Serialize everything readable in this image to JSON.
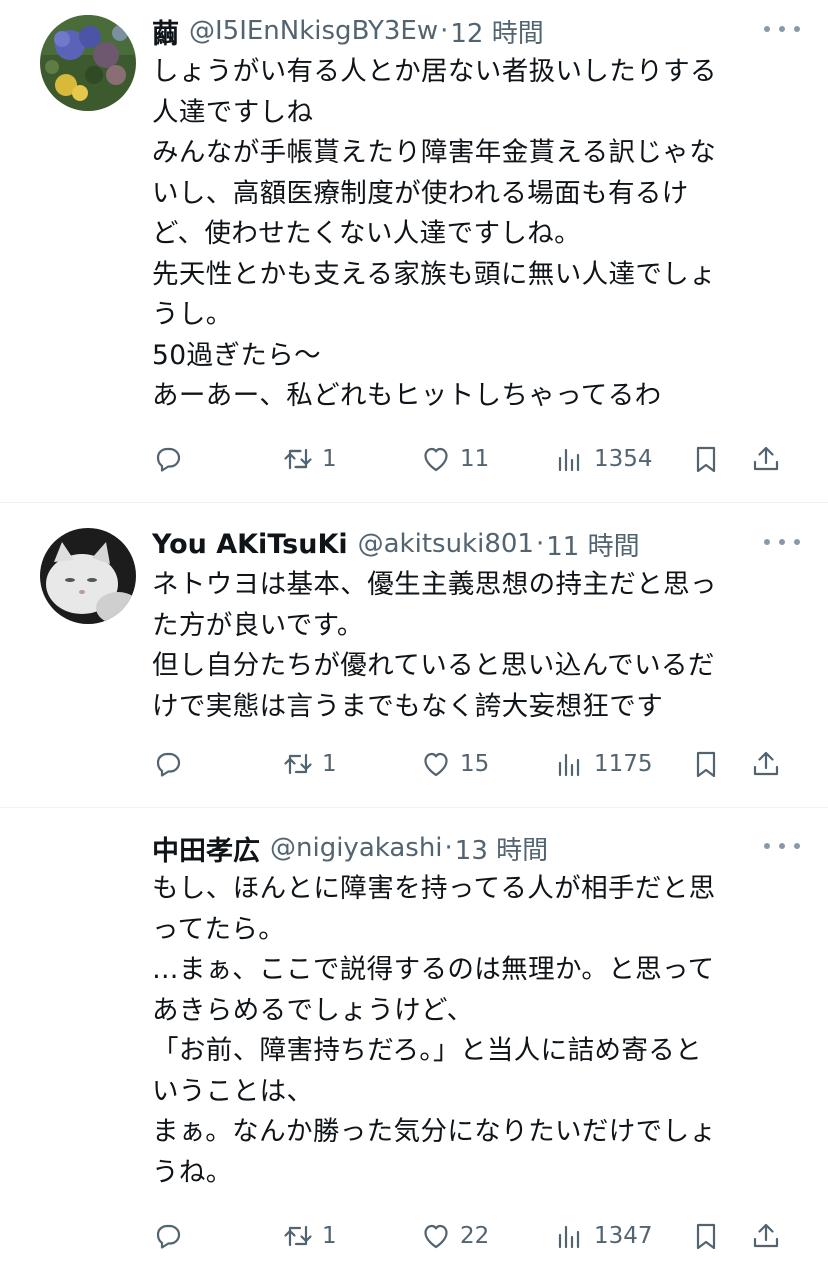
{
  "tweets": [
    {
      "name": "繭",
      "handle": "@I5IEnNkisgBY3Ew",
      "separator": "·",
      "time": "12 時間",
      "lines": [
        "しょうがい有る人とか居ない者扱いしたりする",
        "人達ですしね",
        "みんなが手帳貰えたり障害年金貰える訳じゃな",
        "いし、高額医療制度が使われる場面も有るけ",
        "ど、使わせたくない人達ですしね。",
        "先天性とかも支える家族も頭に無い人達でしょ",
        "うし。",
        "50過ぎたら〜",
        "あーあー、私どれもヒットしちゃってるわ"
      ],
      "retweets": "1",
      "likes": "11",
      "views": "1354"
    },
    {
      "name": "You AKiTsuKi",
      "handle": "@akitsuki801",
      "separator": "·",
      "time": "11 時間",
      "lines": [
        "ネトウヨは基本、優生主義思想の持主だと思っ",
        "た方が良いです。",
        "但し自分たちが優れていると思い込んでいるだ",
        "けで実態は言うまでもなく誇大妄想狂です"
      ],
      "retweets": "1",
      "likes": "15",
      "views": "1175"
    },
    {
      "name": "中田孝広",
      "handle": "@nigiyakashi",
      "separator": "·",
      "time": "13 時間",
      "lines": [
        "もし、ほんとに障害を持ってる人が相手だと思",
        "ってたら。",
        "…まぁ、ここで説得するのは無理か。と思って",
        "あきらめるでしょうけど、",
        "「お前、障害持ちだろ。」と当人に詰め寄ると",
        "いうことは、",
        "まぁ。なんか勝った気分になりたいだけでしょ",
        "うね。"
      ],
      "retweets": "1",
      "likes": "22",
      "views": "1347"
    }
  ],
  "icons": {
    "reply": "reply-icon",
    "retweet": "retweet-icon",
    "like": "heart-icon",
    "views": "views-icon",
    "bookmark": "bookmark-icon",
    "share": "share-icon",
    "more": "more-icon"
  },
  "colors": {
    "text": "#0f1419",
    "secondary": "#536471",
    "divider": "#eff3f4"
  }
}
